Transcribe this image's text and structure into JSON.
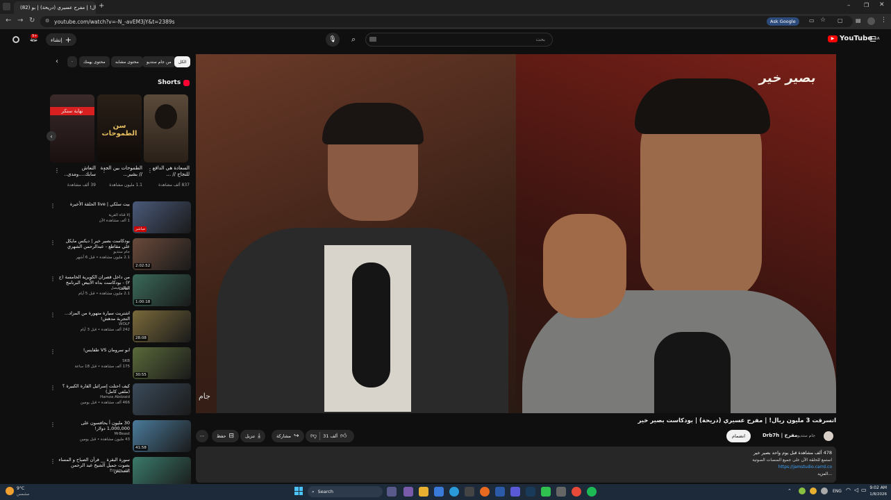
{
  "browser": {
    "tab_title": "(82) اتسرقت 3 مليون ريال! | مفرح عسيري (دريحة) | بو...",
    "url": "youtube.com/watch?v=-N_-avEM3jY&t=2389s",
    "ask_google": "Ask Google"
  },
  "header": {
    "logo": "YouTube",
    "logo_sup": "SA",
    "search_placeholder": "بحث",
    "create_label": "إنشاء",
    "notif_count": "9+"
  },
  "chips": [
    "الكل",
    "من جام ستديو",
    "محتوى مشابه",
    "محتوى يهمك"
  ],
  "shorts": {
    "title": "Shorts",
    "items": [
      {
        "title": "السعادة هي الدافع للنجاح // ...",
        "views": "837 ألف مشاهدة",
        "thumb_color": "#4a3a2a"
      },
      {
        "title": "الطموحات بين الجدة // بشير...",
        "views": "1.1 مليون مشاهدة",
        "thumb_color": "#1c1410",
        "overlay": "سن الطموحات"
      },
      {
        "title": "التعاش سابك....ومدى..",
        "views": "39 ألف مشاهدة",
        "thumb_color": "#2a2020",
        "overlay": "نهاية سنكر"
      }
    ]
  },
  "related": [
    {
      "title": "بيت سلكي | live الحلقة الأخيرة",
      "channel": "إلا قناة القرية",
      "meta": "1 ألف مشاهدة الآن",
      "dur": "مباشر",
      "thumb_color": "#4a5a7a"
    },
    {
      "title": "بودكاست بصير خير | ديكس مايكل علي مقاطع - عبدالرحمن الشهري",
      "channel": "جام ستديو",
      "meta": "2.1 مليون مشاهدة • قبل 6 أشهر",
      "dur": "2:02:52",
      "thumb_color": "#6a4a3a"
    },
    {
      "title": "من داخل قصران الكويرية الخامسة (ج ٢) - بودكاست بداه الأبيض البرنامج الثالث",
      "channel": "بسمة فيصل",
      "meta": "2.1 مليون مشاهدة • قبل 5 أيام",
      "dur": "1:00:18",
      "thumb_color": "#3a6a5a"
    },
    {
      "title": "اشتريت سيارة متهورة من المزاد... التجربة مدهش!",
      "channel": "WOLF",
      "meta": "242 ألف مشاهدة • قبل 3 أيام",
      "dur": "28:08",
      "thumb_color": "#7a6a3a"
    },
    {
      "title": "ابو سرومان VS طفايس!",
      "channel": "SKB",
      "meta": "175 ألف مشاهدة • قبل 18 ساعة",
      "dur": "30:55",
      "thumb_color": "#5a6a3a"
    },
    {
      "title": "كيف احتلت إسرائيل القارة الكبيرة ؟ (ملفي كامل)",
      "channel": "Hamza Abdzaid",
      "meta": "466 ألف مشاهدة • قبل يومين",
      "dur": "",
      "thumb_color": "#3a4a5a"
    },
    {
      "title": "30 مليون أ يحافسون على 1,000,000 دولار!",
      "channel": "MrBeast",
      "meta": "43 مليون مشاهدة • قبل يومين",
      "dur": "41:58",
      "thumb_color": "#4a7a9a"
    },
    {
      "title": "سورة البقرة __ قرآن الصباح و المساء بصوت جميل الشيخ عبد الرحمن السديس",
      "channel": "إمام Emam",
      "meta": "",
      "dur": "",
      "thumb_color": "#3a7a6a"
    }
  ],
  "player": {
    "watermark": "بصير خير",
    "corner_mark": "جام"
  },
  "video": {
    "title": "اتسرقت 3 مليون ريال! | مفرح عسيري (دريحة) | بودكاست بصير خير",
    "channel": "Drb7h | مفرح",
    "channel_extra": "جام ستديو",
    "join": "انضمام",
    "likes": "31 ألف",
    "share": "مشاركة",
    "download": "تنزيل",
    "save": "حفظ"
  },
  "description": {
    "stats": "478 ألف مشاهدة  قبل يوم واحد  بصير خير",
    "line1": "استمع للحلقة الآن على جميع المنصات الصوتية",
    "link": "https://jamstudio.carrd.co",
    "more": "...المزيد"
  },
  "taskbar": {
    "weather_temp": "9°C",
    "weather_desc": "مشمس",
    "search_label": "Search",
    "lang": "ENG",
    "time": "9:02 AM",
    "date": "1/8/2026"
  }
}
